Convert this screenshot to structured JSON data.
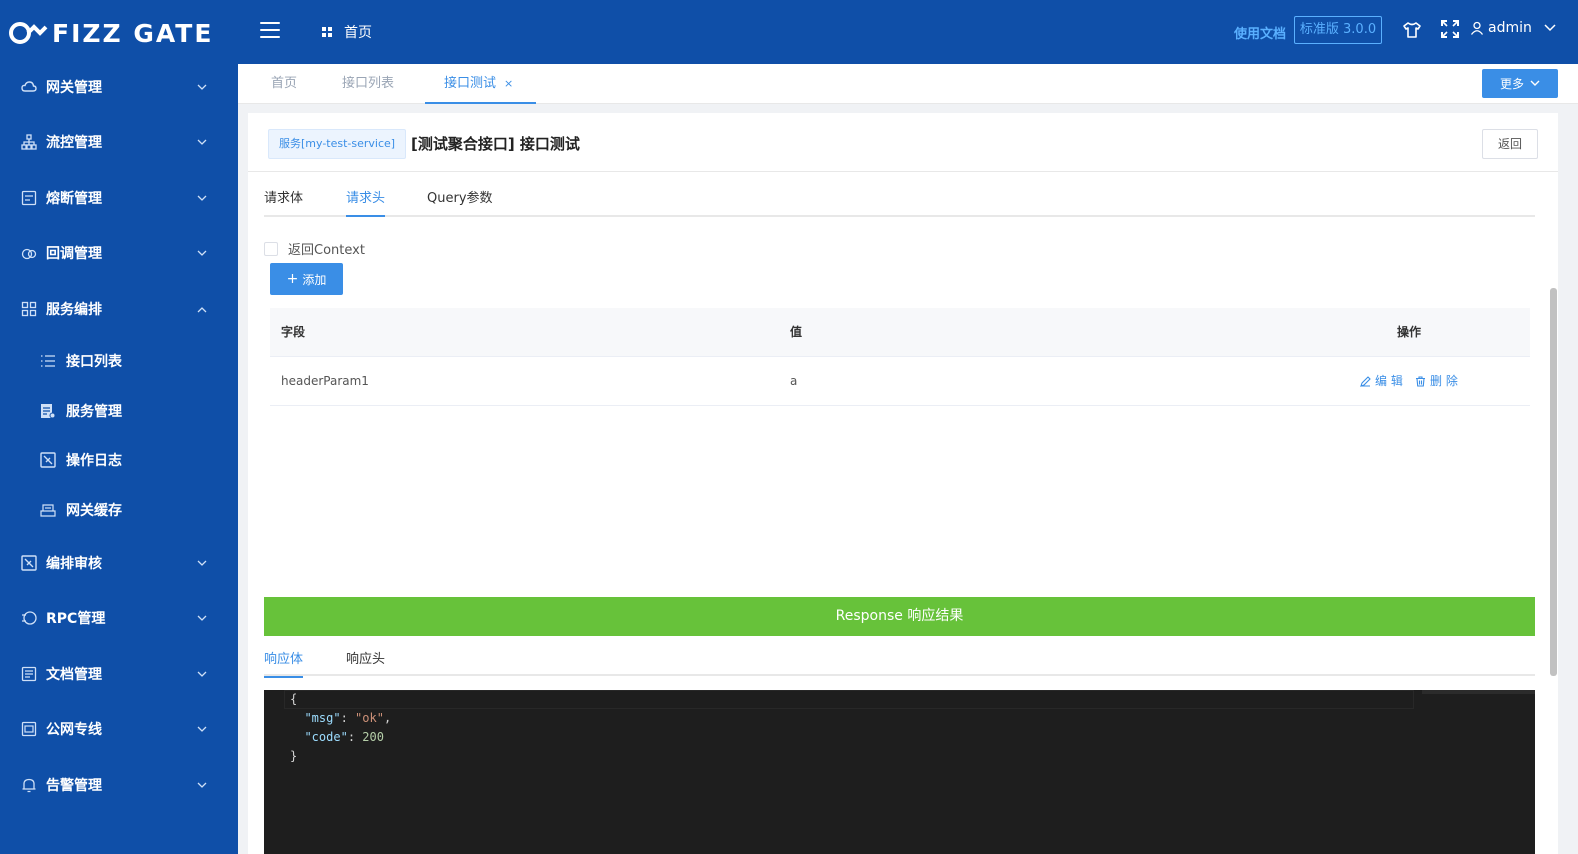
{
  "brand": {
    "name": "FIZZ GATE"
  },
  "header": {
    "breadcrumb_home": "首页",
    "doc_link": "使用文档",
    "version": "标准版 3.0.0",
    "user": "admin"
  },
  "sidebar": {
    "items": [
      {
        "label": "网关管理",
        "icon": "cloud-icon"
      },
      {
        "label": "流控管理",
        "icon": "sitemap-icon"
      },
      {
        "label": "熔断管理",
        "icon": "circuit-icon"
      },
      {
        "label": "回调管理",
        "icon": "callback-icon"
      },
      {
        "label": "服务编排",
        "icon": "grid-icon"
      },
      {
        "label": "接口列表",
        "icon": "list-icon"
      },
      {
        "label": "服务管理",
        "icon": "service-icon"
      },
      {
        "label": "操作日志",
        "icon": "log-icon"
      },
      {
        "label": "网关缓存",
        "icon": "cache-icon"
      },
      {
        "label": "编排审核",
        "icon": "audit-icon"
      },
      {
        "label": "RPC管理",
        "icon": "rpc-icon"
      },
      {
        "label": "文档管理",
        "icon": "doc-icon"
      },
      {
        "label": "公网专线",
        "icon": "network-icon"
      },
      {
        "label": "告警管理",
        "icon": "bell-icon"
      }
    ]
  },
  "tabs": {
    "items": [
      {
        "label": "首页"
      },
      {
        "label": "接口列表"
      },
      {
        "label": "接口测试"
      }
    ],
    "close": "×",
    "more": "更多"
  },
  "page": {
    "service_tag": "服务[my-test-service]",
    "title": "[测试聚合接口] 接口测试",
    "back": "返回"
  },
  "request_tabs": [
    "请求体",
    "请求头",
    "Query参数"
  ],
  "context_label": "返回Context",
  "add_button": "添加",
  "table": {
    "headers": [
      "字段",
      "值",
      "操作"
    ],
    "rows": [
      {
        "field": "headerParam1",
        "value": "a"
      }
    ],
    "edit": "编 辑",
    "delete": "删 除"
  },
  "response": {
    "bar": "Response 响应结果",
    "tabs": [
      "响应体",
      "响应头"
    ],
    "code": {
      "open": "{",
      "msg_key": "\"msg\"",
      "msg_val": "\"ok\"",
      "code_key": "\"code\"",
      "code_val": "200",
      "close": "}"
    }
  },
  "colors": {
    "primary": "#0f4fa8",
    "accent": "#3a8ee6",
    "success": "#67c23a"
  }
}
